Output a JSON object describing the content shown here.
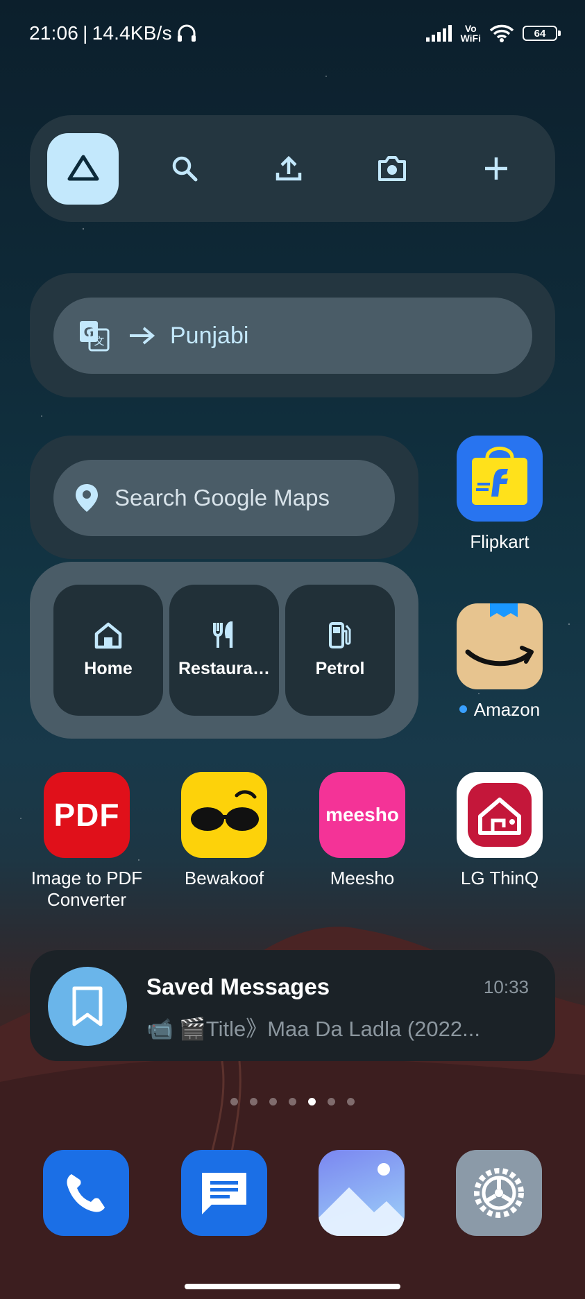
{
  "status_bar": {
    "time": "21:06",
    "separator": "|",
    "net_speed": "14.4KB/s",
    "vowifi_top": "Vo",
    "vowifi_bottom": "WiFi",
    "battery": "64"
  },
  "drive_widget": {
    "icons": [
      "drive-logo-icon",
      "search-icon",
      "upload-icon",
      "camera-icon",
      "plus-icon"
    ],
    "accent_color": "#c3e8fc"
  },
  "translate_widget": {
    "target_language": "Punjabi",
    "icon": "google-translate-icon"
  },
  "maps_widget": {
    "search_placeholder": "Search Google Maps",
    "shortcuts": [
      {
        "label": "Home",
        "icon": "home-icon"
      },
      {
        "label": "Restaura…",
        "icon": "restaurant-icon"
      },
      {
        "label": "Petrol",
        "icon": "fuel-icon"
      }
    ]
  },
  "apps": {
    "flipkart": "Flipkart",
    "amazon": "Amazon",
    "pdf_icon_text": "PDF",
    "pdf_line1": "Image to PDF",
    "pdf_line2": "Converter",
    "bewakoof": "Bewakoof",
    "meesho": "Meesho",
    "meesho_icon_text": "meesho",
    "lg": "LG ThinQ"
  },
  "telegram_widget": {
    "title": "Saved Messages",
    "time": "10:33",
    "message": "📹 🎬Title》Maa Da Ladla  (2022..."
  },
  "pager": {
    "count": 7,
    "active_index": 4
  },
  "dock": {
    "icons": [
      "phone-icon",
      "messages-icon",
      "gallery-icon",
      "settings-icon"
    ]
  }
}
